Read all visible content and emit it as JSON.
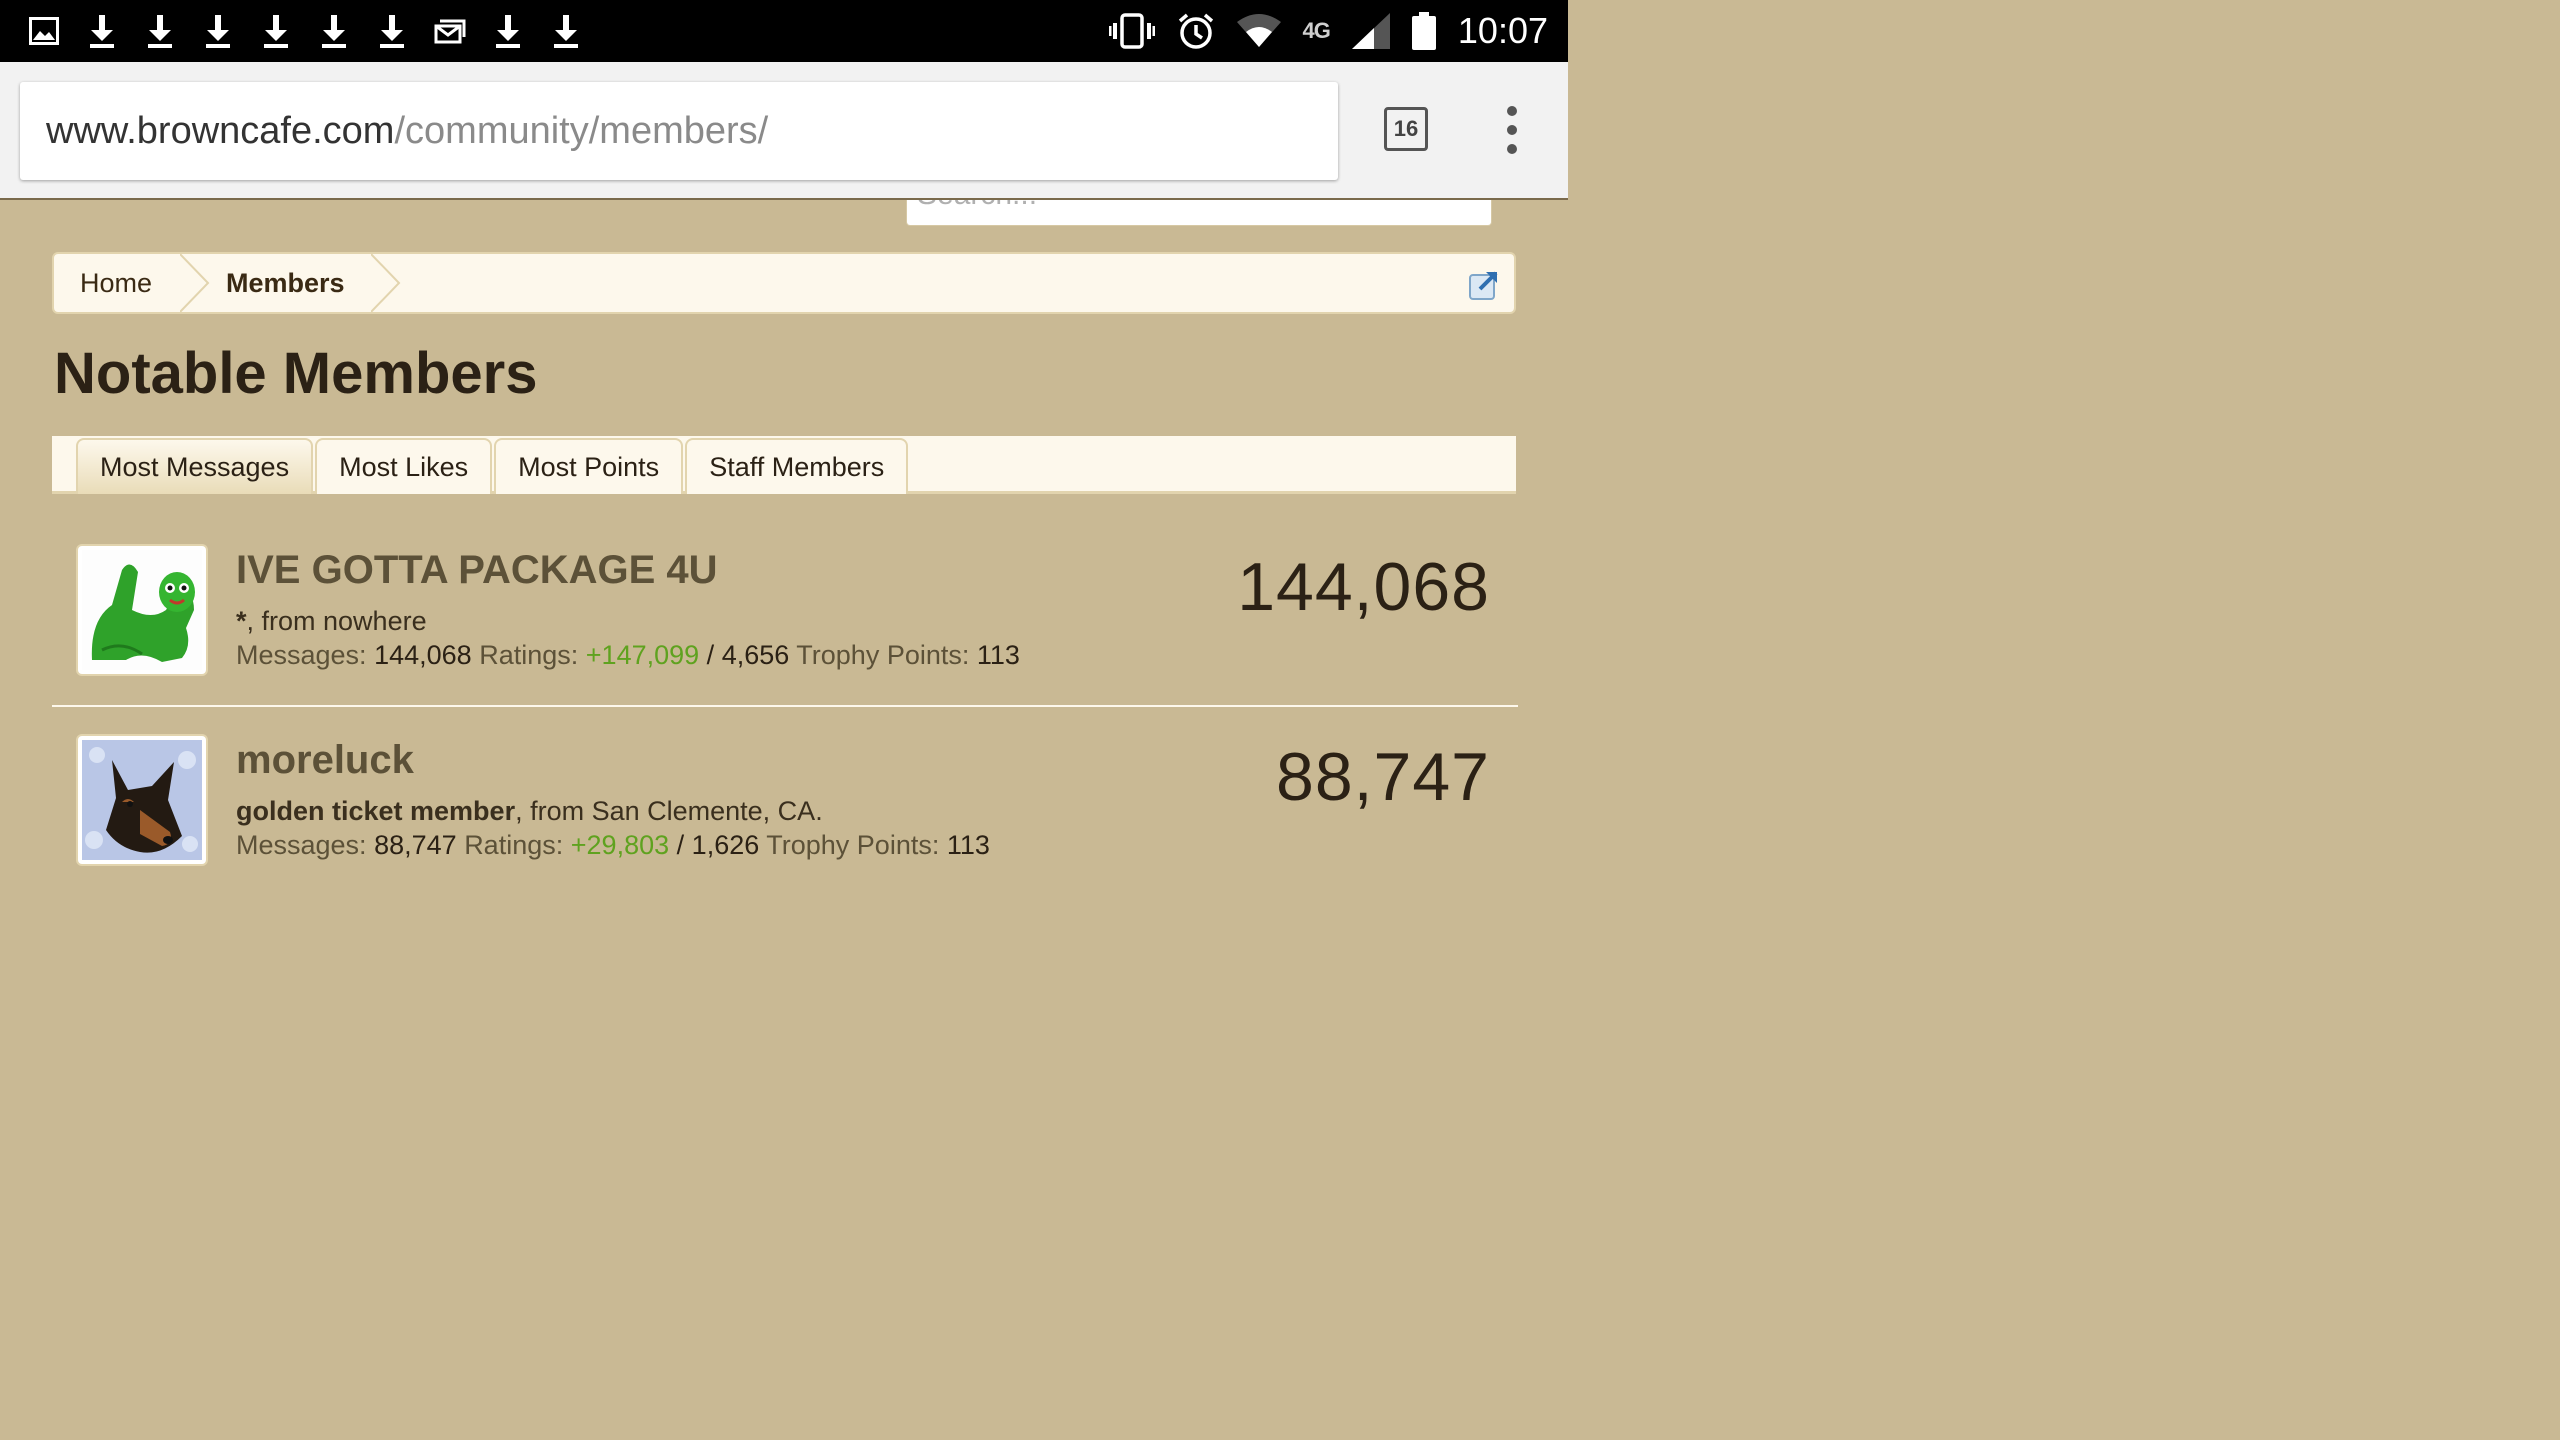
{
  "status_bar": {
    "clock": "10:07",
    "network_label": "4G",
    "left_icons": [
      "image-icon",
      "download-icon",
      "download-icon",
      "download-icon",
      "download-icon",
      "download-icon",
      "download-icon",
      "mail-icon",
      "download-icon",
      "download-icon"
    ],
    "right_icons": [
      "vibrate-icon",
      "alarm-icon",
      "wifi-icon",
      "lte-icon",
      "signal-icon",
      "battery-icon"
    ]
  },
  "browser": {
    "url_host": "www.browncafe.com",
    "url_path": "/community/members/",
    "tab_count": "16"
  },
  "search": {
    "placeholder": "Search..."
  },
  "breadcrumb": {
    "items": [
      {
        "label": "Home"
      },
      {
        "label": "Members"
      }
    ]
  },
  "page_title": "Notable Members",
  "tabs": [
    {
      "label": "Most Messages",
      "active": true
    },
    {
      "label": "Most Likes"
    },
    {
      "label": "Most Points"
    },
    {
      "label": "Staff Members"
    }
  ],
  "members": [
    {
      "name": "IVE GOTTA PACKAGE 4U",
      "title_bold": "*",
      "title_rest": ", from nowhere",
      "messages_label": "Messages:",
      "messages": "144,068",
      "ratings_label": "Ratings:",
      "ratings_positive": "+147,099",
      "ratings_sep": "/",
      "ratings_other": "4,656",
      "trophy_label": "Trophy Points:",
      "trophy": "113",
      "count": "144,068"
    },
    {
      "name": "moreluck",
      "title_bold": "golden ticket member",
      "title_rest": ", from San Clemente, CA.",
      "messages_label": "Messages:",
      "messages": "88,747",
      "ratings_label": "Ratings:",
      "ratings_positive": "+29,803",
      "ratings_sep": "/",
      "ratings_other": "1,626",
      "trophy_label": "Trophy Points:",
      "trophy": "113",
      "count": "88,747"
    }
  ],
  "colors": {
    "page_bg": "#c9b994",
    "panel_bg": "#fdf8ec",
    "positive_rating": "#5fa21f",
    "username": "#5c5138"
  }
}
